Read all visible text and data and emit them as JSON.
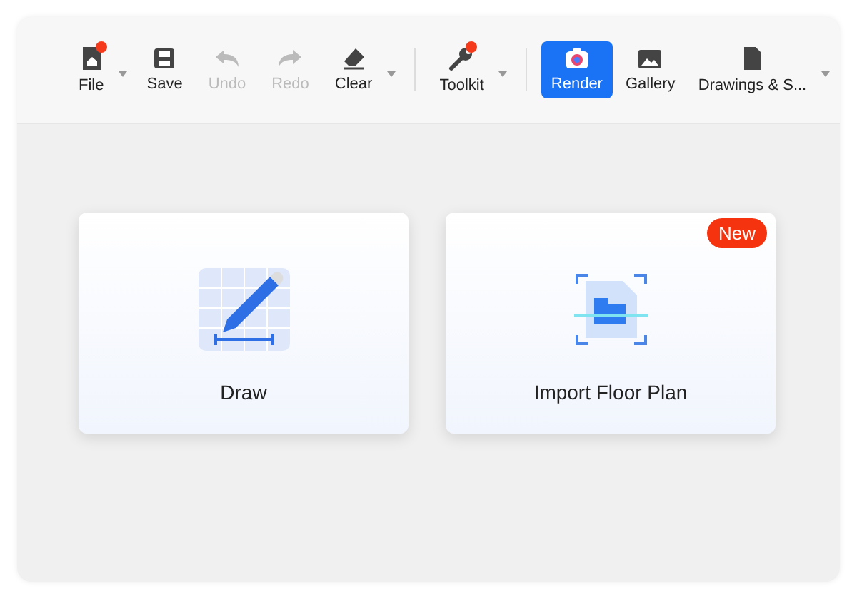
{
  "toolbar": {
    "groups": [
      {
        "items": [
          {
            "label": "File",
            "disabled": false,
            "selected": false,
            "dot": true,
            "dropdown": true
          },
          {
            "label": "Save",
            "disabled": false,
            "selected": false,
            "dot": false,
            "dropdown": false
          },
          {
            "label": "Undo",
            "disabled": true,
            "selected": false,
            "dot": false,
            "dropdown": false
          },
          {
            "label": "Redo",
            "disabled": true,
            "selected": false,
            "dot": false,
            "dropdown": false
          },
          {
            "label": "Clear",
            "disabled": false,
            "selected": false,
            "dot": false,
            "dropdown": true
          }
        ]
      },
      {
        "items": [
          {
            "label": "Toolkit",
            "disabled": false,
            "selected": false,
            "dot": true,
            "dropdown": true
          }
        ]
      },
      {
        "items": [
          {
            "label": "Render",
            "disabled": false,
            "selected": true,
            "dot": false,
            "dropdown": false
          },
          {
            "label": "Gallery",
            "disabled": false,
            "selected": false,
            "dot": false,
            "dropdown": false
          },
          {
            "label": "Drawings & S...",
            "disabled": false,
            "selected": false,
            "dot": false,
            "dropdown": true
          }
        ]
      }
    ]
  },
  "cards": [
    {
      "label": "Draw"
    },
    {
      "label": "Import Floor Plan",
      "badge": "New"
    }
  ]
}
